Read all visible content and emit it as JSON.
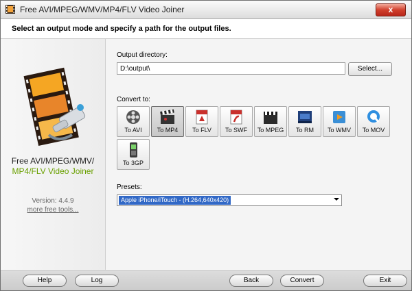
{
  "window": {
    "title": "Free AVI/MPEG/WMV/MP4/FLV Video Joiner"
  },
  "header": {
    "instruction": "Select an output mode and specify a path for the output files."
  },
  "sidebar": {
    "product_line1": "Free AVI/MPEG/WMV/",
    "product_line2": "MP4/FLV Video Joiner",
    "version": "Version: 4.4.9",
    "more_tools": "more free tools..."
  },
  "output": {
    "label": "Output directory:",
    "value": "D:\\output\\",
    "select_label": "Select..."
  },
  "convert": {
    "label": "Convert to:",
    "formats": [
      {
        "label": "To AVI",
        "icon": "film-reel-icon",
        "selected": false
      },
      {
        "label": "To MP4",
        "icon": "clapperboard-icon",
        "selected": true
      },
      {
        "label": "To FLV",
        "icon": "flv-file-icon",
        "selected": false
      },
      {
        "label": "To SWF",
        "icon": "swf-file-icon",
        "selected": false
      },
      {
        "label": "To MPEG",
        "icon": "clapperboard-icon",
        "selected": false
      },
      {
        "label": "To RM",
        "icon": "real-icon",
        "selected": false
      },
      {
        "label": "To WMV",
        "icon": "windows-media-icon",
        "selected": false
      },
      {
        "label": "To MOV",
        "icon": "quicktime-icon",
        "selected": false
      },
      {
        "label": "To 3GP",
        "icon": "mobile-phone-icon",
        "selected": false
      }
    ]
  },
  "presets": {
    "label": "Presets:",
    "selected": "Apple iPhone/iTouch - (H.264,640x420)"
  },
  "buttons": {
    "help": "Help",
    "log": "Log",
    "back": "Back",
    "convert": "Convert",
    "exit": "Exit",
    "close": "x"
  },
  "colors": {
    "accent_green": "#6aa000",
    "selection_blue": "#3168c6",
    "close_red": "#d1402d"
  }
}
